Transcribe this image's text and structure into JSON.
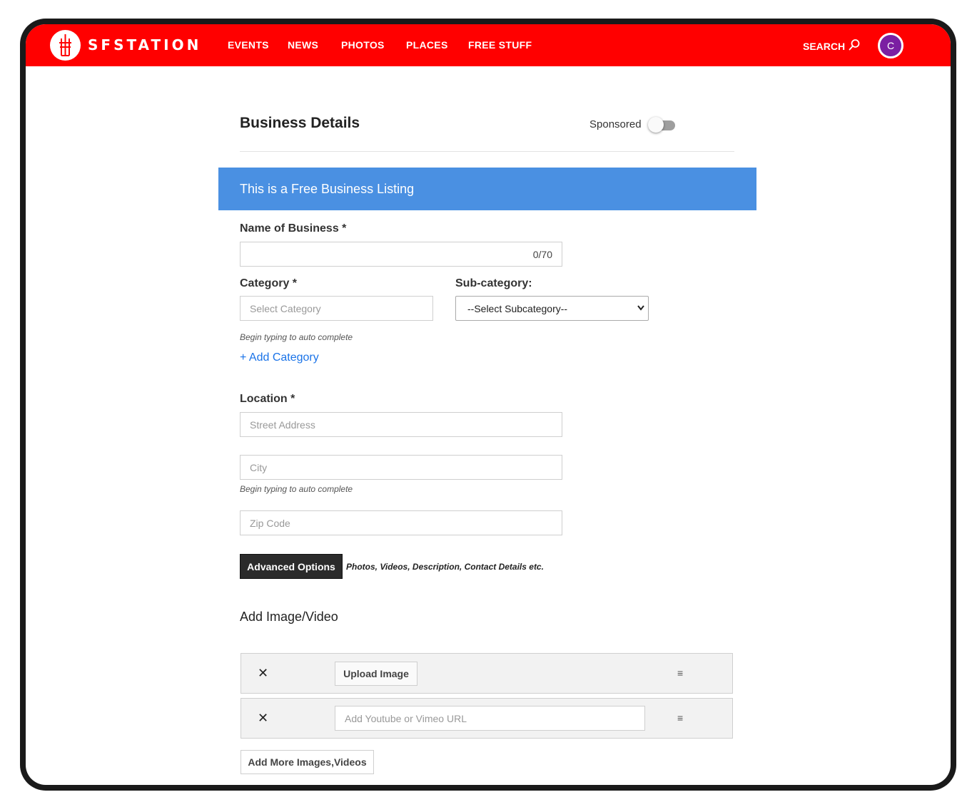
{
  "brand": {
    "name": "SFSTATION",
    "accent": "#ff0000"
  },
  "nav": {
    "items": [
      "EVENTS",
      "NEWS",
      "PHOTOS",
      "PLACES",
      "FREE STUFF"
    ],
    "search_label": "SEARCH",
    "avatar_initial": "C"
  },
  "form": {
    "title": "Business Details",
    "sponsored_label": "Sponsored",
    "banner": "This is a Free Business Listing",
    "name_label": "Name of Business *",
    "name_counter": "0/70",
    "category_label": "Category *",
    "category_placeholder": "Select Category",
    "category_hint": "Begin typing to auto complete",
    "add_category": "+ Add Category",
    "subcategory_label": "Sub-category:",
    "subcategory_selected": "--Select Subcategory--",
    "location_label": "Location *",
    "street_placeholder": "Street Address",
    "city_placeholder": "City",
    "city_hint": "Begin typing to auto complete",
    "zip_placeholder": "Zip Code",
    "advanced_button": "Advanced Options",
    "advanced_note": "Photos, Videos, Description, Contact Details etc."
  },
  "media": {
    "title": "Add Image/Video",
    "remove_glyph": "✕",
    "drag_glyph": "≡",
    "upload_button": "Upload Image",
    "url_placeholder": "Add Youtube or Vimeo URL",
    "add_more_button": "Add More Images,Videos"
  },
  "icons": [
    "logo-tower-icon",
    "search-icon",
    "chevron-down-icon",
    "close-icon",
    "drag-handle-icon"
  ]
}
